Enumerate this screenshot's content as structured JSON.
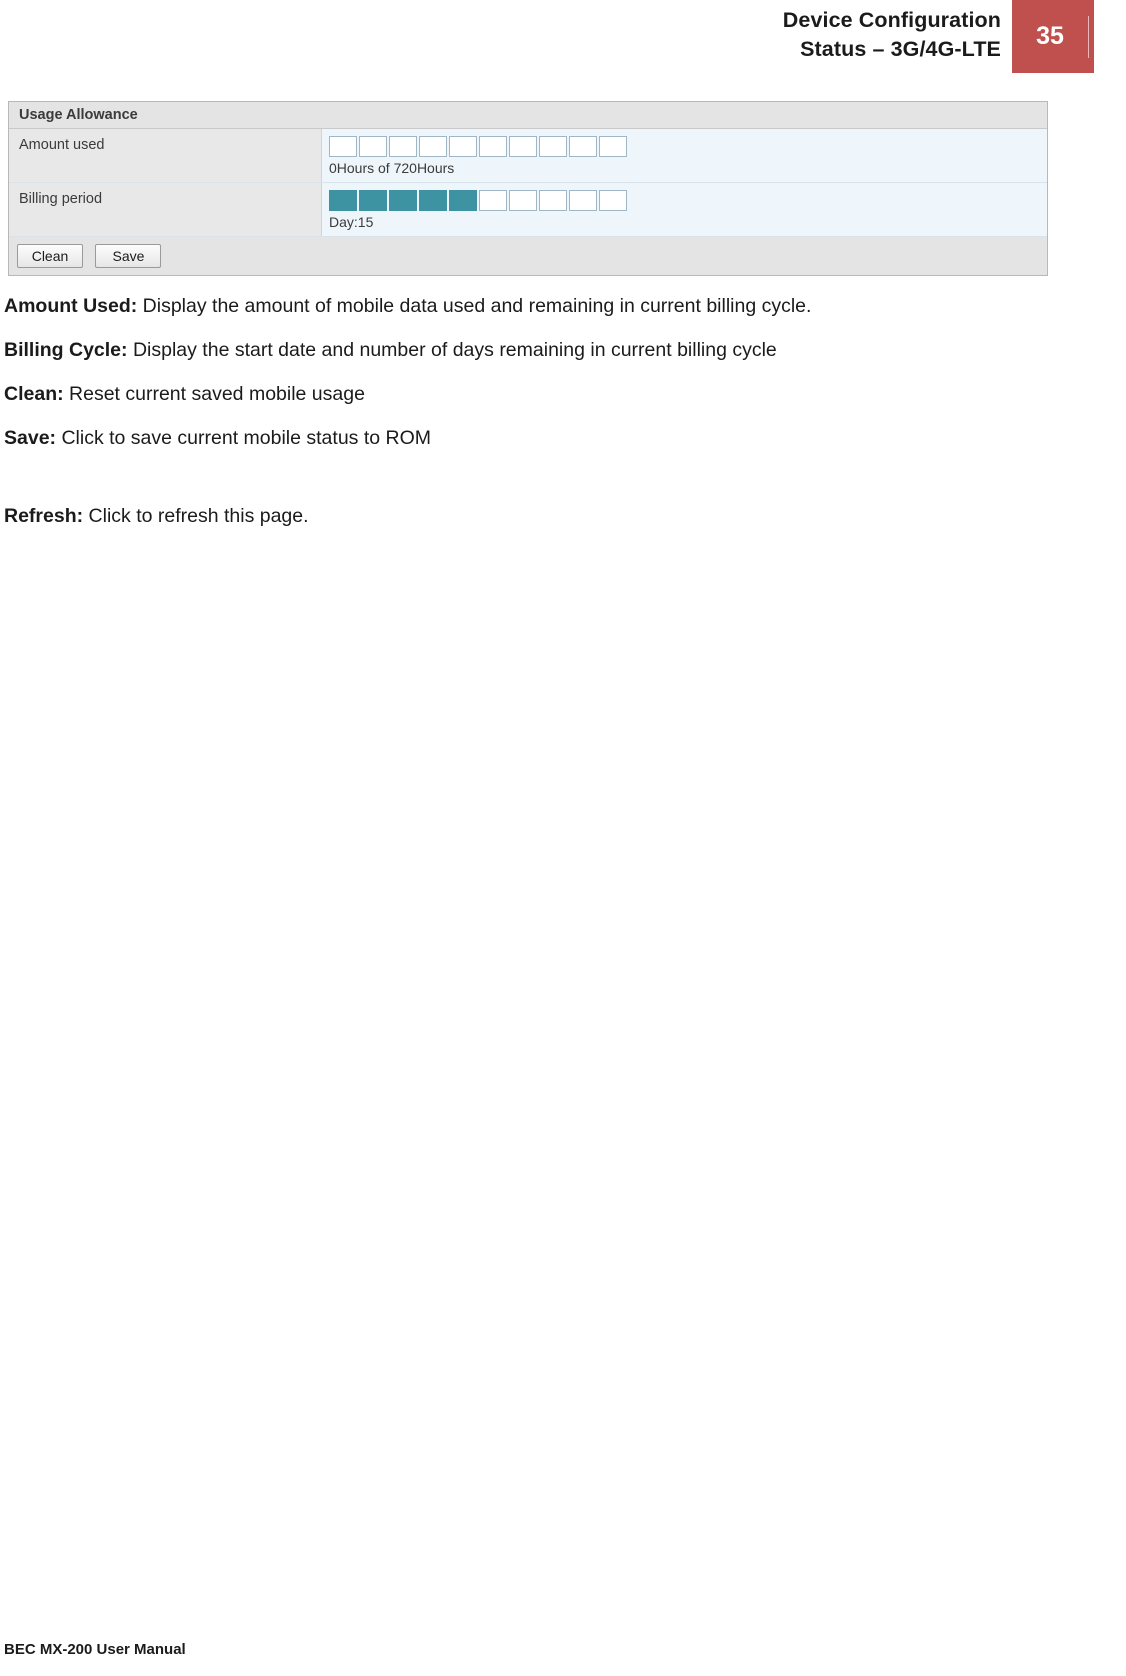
{
  "header": {
    "title_line1": "Device Configuration",
    "title_line2": "Status – 3G/4G-LTE",
    "page_number": "35"
  },
  "screenshot": {
    "panel_title": "Usage Allowance",
    "rows": [
      {
        "label": "Amount used",
        "caption": "0Hours of 720Hours",
        "total_blocks": 10,
        "filled_blocks": 0
      },
      {
        "label": "Billing period",
        "caption": "Day:15",
        "total_blocks": 10,
        "filled_blocks": 5
      }
    ],
    "buttons": [
      {
        "label": "Clean",
        "name": "clean-button"
      },
      {
        "label": "Save",
        "name": "save-button"
      }
    ],
    "accent_color": "#3e93a3"
  },
  "body": {
    "items": [
      {
        "term": "Amount Used:",
        "description": " Display the amount of mobile data used and remaining in current billing cycle."
      },
      {
        "term": "Billing Cycle:",
        "description": " Display the start date and number of days remaining in current billing cycle"
      },
      {
        "term": "Clean:",
        "description": " Reset current saved mobile usage"
      },
      {
        "term": "Save:",
        "description": " Click to save current mobile status to ROM"
      },
      {
        "term": "Refresh:",
        "description": " Click to refresh this page."
      }
    ]
  },
  "footer": {
    "text": "BEC MX-200 User Manual"
  }
}
